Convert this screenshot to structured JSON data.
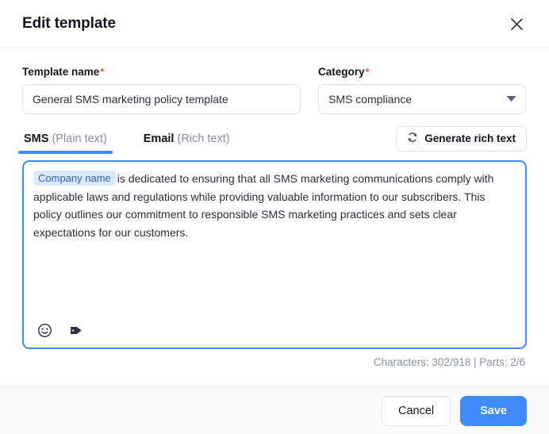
{
  "header": {
    "title": "Edit template",
    "close_icon": "close-icon"
  },
  "form": {
    "template_name": {
      "label": "Template name",
      "required_marker": "*",
      "value": "General SMS marketing policy template",
      "placeholder": "Template name"
    },
    "category": {
      "label": "Category",
      "required_marker": "*",
      "value": "SMS compliance",
      "caret_icon": "chevron-down-icon"
    }
  },
  "tabs": [
    {
      "main": "SMS",
      "sub": "(Plain text)",
      "active": true
    },
    {
      "main": "Email",
      "sub": "(Rich text)",
      "active": false
    }
  ],
  "generate_button": {
    "label": "Generate rich text",
    "icon": "refresh-icon"
  },
  "editor": {
    "merge_tag": "Company name",
    "body": "is dedicated to ensuring that all SMS marketing communications comply with applicable laws and regulations while providing valuable information to our subscribers. This policy outlines our commitment to responsible SMS marketing practices and sets clear expectations for our customers.",
    "toolbar": [
      {
        "icon": "emoji-icon"
      },
      {
        "icon": "tag-icon"
      }
    ]
  },
  "counter": {
    "text": "Characters: 302/918  |  Parts: 2/6",
    "characters_used": 302,
    "characters_limit": 918,
    "parts_used": 2,
    "parts_limit": 6
  },
  "footer": {
    "cancel_label": "Cancel",
    "save_label": "Save"
  },
  "colors": {
    "accent": "#3d8bfd",
    "required": "#e8574a",
    "chip_bg": "#dbeafe",
    "chip_text": "#2563c9",
    "muted_text": "#8b90a8"
  }
}
